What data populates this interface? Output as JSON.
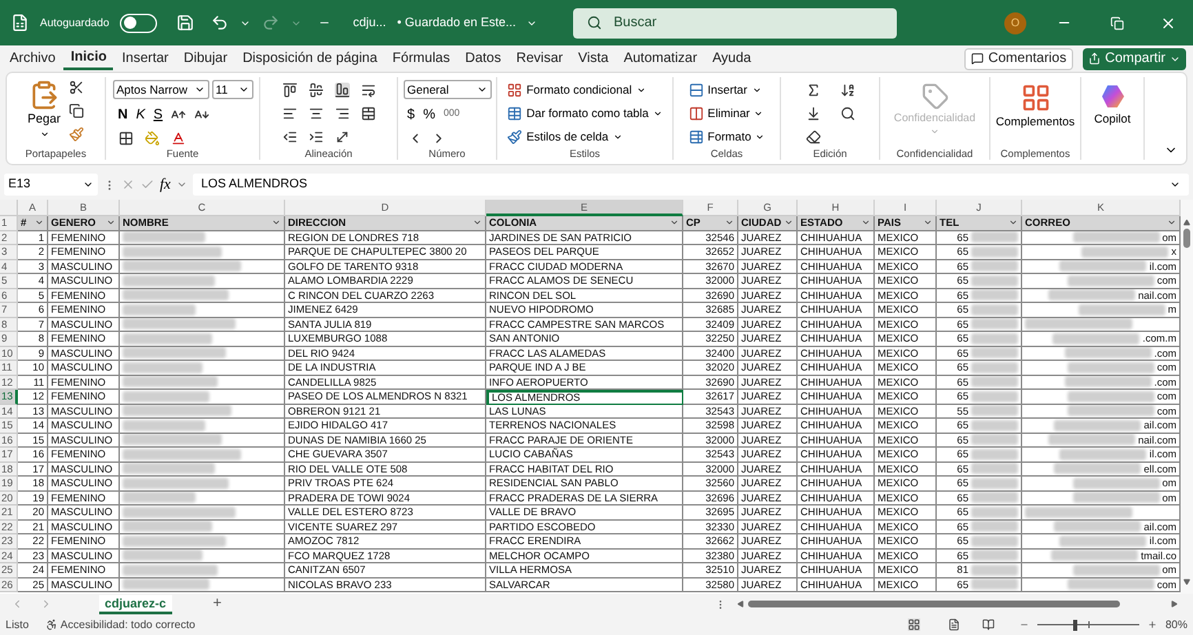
{
  "title_bar": {
    "autosave_label": "Autoguardado",
    "autosave_on": false,
    "file_name": "cdju...",
    "save_status": "• Guardado en Este...",
    "search_placeholder": "Buscar",
    "avatar_initial": "O"
  },
  "menu": {
    "tabs": [
      {
        "label": "Archivo",
        "selected": false
      },
      {
        "label": "Inicio",
        "selected": true
      },
      {
        "label": "Insertar",
        "selected": false
      },
      {
        "label": "Dibujar",
        "selected": false
      },
      {
        "label": "Disposición de página",
        "selected": false
      },
      {
        "label": "Fórmulas",
        "selected": false
      },
      {
        "label": "Datos",
        "selected": false
      },
      {
        "label": "Revisar",
        "selected": false
      },
      {
        "label": "Vista",
        "selected": false
      },
      {
        "label": "Automatizar",
        "selected": false
      },
      {
        "label": "Ayuda",
        "selected": false
      }
    ],
    "comments_button": "Comentarios",
    "share_button": "Compartir"
  },
  "ribbon": {
    "groups": [
      {
        "kind": "clipboard",
        "label": "Portapapeles",
        "paste": "Pegar"
      },
      {
        "kind": "font",
        "label": "Fuente",
        "font_name": "Aptos Narrow",
        "font_size": "11",
        "bold": "N",
        "italic": "K",
        "underline": "S"
      },
      {
        "kind": "alignment",
        "label": "Alineación"
      },
      {
        "kind": "number",
        "label": "Número",
        "format": "General",
        "currency": "$",
        "percent": "%",
        "thousands": "000"
      },
      {
        "kind": "styles",
        "label": "Estilos",
        "items": [
          "Formato condicional",
          "Dar formato como tabla",
          "Estilos de celda"
        ]
      },
      {
        "kind": "cells",
        "label": "Celdas",
        "items": [
          "Insertar",
          "Eliminar",
          "Formato"
        ]
      },
      {
        "kind": "editing",
        "label": "Edición"
      },
      {
        "kind": "sensitivity",
        "label": "Confidencialidad",
        "button": "Confidencialidad",
        "disabled": true
      },
      {
        "kind": "addins",
        "label": "Complementos",
        "button": "Complementos"
      },
      {
        "kind": "copilot",
        "button": "Copilot"
      }
    ]
  },
  "formula_bar": {
    "cell_ref": "E13",
    "fx": "fx",
    "value": "LOS ALMENDROS"
  },
  "sheet": {
    "columns": [
      {
        "letter": "A",
        "header": "#",
        "kind": "number",
        "selected": false
      },
      {
        "letter": "B",
        "header": "GENERO",
        "kind": "text",
        "selected": false
      },
      {
        "letter": "C",
        "header": "NOMBRE",
        "kind": "blurred",
        "selected": false
      },
      {
        "letter": "D",
        "header": "DIRECCION",
        "kind": "text",
        "selected": false
      },
      {
        "letter": "E",
        "header": "COLONIA",
        "kind": "text",
        "selected": true
      },
      {
        "letter": "F",
        "header": "CP",
        "kind": "number",
        "selected": false
      },
      {
        "letter": "G",
        "header": "CIUDAD",
        "kind": "text",
        "selected": false
      },
      {
        "letter": "H",
        "header": "ESTADO",
        "kind": "text",
        "selected": false
      },
      {
        "letter": "I",
        "header": "PAIS",
        "kind": "text",
        "selected": false
      },
      {
        "letter": "J",
        "header": "TEL",
        "kind": "blurred-number",
        "selected": false
      },
      {
        "letter": "K",
        "header": "CORREO",
        "kind": "blurred-text",
        "selected": false
      }
    ],
    "header_row_number": "1",
    "rows": [
      {
        "row_number": "2",
        "selected": false,
        "cells": [
          "1",
          "FEMENINO",
          "",
          "REGION DE LONDRES 718",
          "JARDINES DE SAN PATRICIO",
          "32546",
          "JUAREZ",
          "CHIHUAHUA",
          "MEXICO",
          "65",
          "om"
        ]
      },
      {
        "row_number": "3",
        "selected": false,
        "cells": [
          "2",
          "FEMENINO",
          "",
          "PARQUE DE CHAPULTEPEC 3800 20",
          "PASEOS DEL PARQUE",
          "32652",
          "JUAREZ",
          "CHIHUAHUA",
          "MEXICO",
          "65",
          "x"
        ]
      },
      {
        "row_number": "4",
        "selected": false,
        "cells": [
          "3",
          "MASCULINO",
          "",
          "GOLFO DE TARENTO 9318",
          "FRACC CIUDAD MODERNA",
          "32670",
          "JUAREZ",
          "CHIHUAHUA",
          "MEXICO",
          "65",
          "il.com"
        ]
      },
      {
        "row_number": "5",
        "selected": false,
        "cells": [
          "4",
          "MASCULINO",
          "",
          "ALAMO LOMBARDIA 2229",
          "FRACC ALAMOS DE SENECU",
          "32000",
          "JUAREZ",
          "CHIHUAHUA",
          "MEXICO",
          "65",
          "com"
        ]
      },
      {
        "row_number": "6",
        "selected": false,
        "cells": [
          "5",
          "FEMENINO",
          "",
          "C RINCON DEL CUARZO 2263",
          "RINCON DEL SOL",
          "32690",
          "JUAREZ",
          "CHIHUAHUA",
          "MEXICO",
          "65",
          "nail.com"
        ]
      },
      {
        "row_number": "7",
        "selected": false,
        "cells": [
          "6",
          "FEMENINO",
          "",
          "JIMENEZ 6429",
          "NUEVO HIPODROMO",
          "32685",
          "JUAREZ",
          "CHIHUAHUA",
          "MEXICO",
          "65",
          "m"
        ]
      },
      {
        "row_number": "8",
        "selected": false,
        "cells": [
          "7",
          "MASCULINO",
          "",
          "SANTA JULIA 819",
          "FRACC CAMPESTRE SAN MARCOS",
          "32409",
          "JUAREZ",
          "CHIHUAHUA",
          "MEXICO",
          "65",
          ""
        ]
      },
      {
        "row_number": "9",
        "selected": false,
        "cells": [
          "8",
          "FEMENINO",
          "",
          "LUXEMBURGO 1088",
          "SAN ANTONIO",
          "32250",
          "JUAREZ",
          "CHIHUAHUA",
          "MEXICO",
          "65",
          ".com.m"
        ]
      },
      {
        "row_number": "10",
        "selected": false,
        "cells": [
          "9",
          "MASCULINO",
          "",
          "DEL RIO 9424",
          "FRACC LAS ALAMEDAS",
          "32400",
          "JUAREZ",
          "CHIHUAHUA",
          "MEXICO",
          "65",
          ".com"
        ]
      },
      {
        "row_number": "11",
        "selected": false,
        "cells": [
          "10",
          "MASCULINO",
          "",
          "DE LA INDUSTRIA",
          "PARQUE IND A J BE",
          "32020",
          "JUAREZ",
          "CHIHUAHUA",
          "MEXICO",
          "65",
          "com"
        ]
      },
      {
        "row_number": "12",
        "selected": false,
        "cells": [
          "11",
          "FEMENINO",
          "",
          "CANDELILLA 9825",
          "INFO AEROPUERTO",
          "32690",
          "JUAREZ",
          "CHIHUAHUA",
          "MEXICO",
          "65",
          ".com"
        ]
      },
      {
        "row_number": "13",
        "selected": true,
        "cells": [
          "12",
          "FEMENINO",
          "",
          "PASEO DE LOS ALMENDROS N 8321",
          "LOS ALMENDROS",
          "32617",
          "JUAREZ",
          "CHIHUAHUA",
          "MEXICO",
          "65",
          "com"
        ]
      },
      {
        "row_number": "14",
        "selected": false,
        "cells": [
          "13",
          "MASCULINO",
          "",
          "OBRERON 9121 21",
          "LAS LUNAS",
          "32543",
          "JUAREZ",
          "CHIHUAHUA",
          "MEXICO",
          "55",
          "com"
        ]
      },
      {
        "row_number": "15",
        "selected": false,
        "cells": [
          "14",
          "MASCULINO",
          "",
          "EJIDO HIDALGO 417",
          "TERRENOS NACIONALES",
          "32598",
          "JUAREZ",
          "CHIHUAHUA",
          "MEXICO",
          "65",
          "ail.com"
        ]
      },
      {
        "row_number": "16",
        "selected": false,
        "cells": [
          "15",
          "MASCULINO",
          "",
          "DUNAS DE NAMIBIA 1660 25",
          "FRACC PARAJE DE ORIENTE",
          "32000",
          "JUAREZ",
          "CHIHUAHUA",
          "MEXICO",
          "65",
          "nail.com"
        ]
      },
      {
        "row_number": "17",
        "selected": false,
        "cells": [
          "16",
          "FEMENINO",
          "",
          "CHE GUEVARA 3507",
          "LUCIO CABAÑAS",
          "32543",
          "JUAREZ",
          "CHIHUAHUA",
          "MEXICO",
          "65",
          "il.com"
        ]
      },
      {
        "row_number": "18",
        "selected": false,
        "cells": [
          "17",
          "MASCULINO",
          "",
          "RIO DEL VALLE OTE 508",
          "FRACC HABITAT DEL RIO",
          "32000",
          "JUAREZ",
          "CHIHUAHUA",
          "MEXICO",
          "65",
          "ell.com"
        ]
      },
      {
        "row_number": "19",
        "selected": false,
        "cells": [
          "18",
          "MASCULINO",
          "",
          "PRIV TROAS PTE 624",
          "RESIDENCIAL SAN PABLO",
          "32560",
          "JUAREZ",
          "CHIHUAHUA",
          "MEXICO",
          "65",
          "om"
        ]
      },
      {
        "row_number": "20",
        "selected": false,
        "cells": [
          "19",
          "FEMENINO",
          "",
          "PRADERA DE TOWI 9024",
          "FRACC PRADERAS DE LA SIERRA",
          "32696",
          "JUAREZ",
          "CHIHUAHUA",
          "MEXICO",
          "65",
          "om"
        ]
      },
      {
        "row_number": "21",
        "selected": false,
        "cells": [
          "20",
          "MASCULINO",
          "",
          "VALLE DEL ESTERO 8723",
          "VALLE DE BRAVO",
          "32695",
          "JUAREZ",
          "CHIHUAHUA",
          "MEXICO",
          "65",
          ""
        ]
      },
      {
        "row_number": "22",
        "selected": false,
        "cells": [
          "21",
          "MASCULINO",
          "",
          "VICENTE SUAREZ 297",
          "PARTIDO ESCOBEDO",
          "32330",
          "JUAREZ",
          "CHIHUAHUA",
          "MEXICO",
          "65",
          "ail.com"
        ]
      },
      {
        "row_number": "23",
        "selected": false,
        "cells": [
          "22",
          "FEMENINO",
          "",
          "AMOZOC 7812",
          "FRACC ERENDIRA",
          "32662",
          "JUAREZ",
          "CHIHUAHUA",
          "MEXICO",
          "65",
          "il.com"
        ]
      },
      {
        "row_number": "24",
        "selected": false,
        "cells": [
          "23",
          "MASCULINO",
          "",
          "FCO MARQUEZ 1728",
          "MELCHOR OCAMPO",
          "32380",
          "JUAREZ",
          "CHIHUAHUA",
          "MEXICO",
          "65",
          "tmail.co"
        ]
      },
      {
        "row_number": "25",
        "selected": false,
        "cells": [
          "24",
          "FEMENINO",
          "",
          "CANITZAN 6507",
          "VILLA HERMOSA",
          "32510",
          "JUAREZ",
          "CHIHUAHUA",
          "MEXICO",
          "81",
          "om"
        ]
      },
      {
        "row_number": "26",
        "selected": false,
        "cells": [
          "25",
          "MASCULINO",
          "",
          "NICOLAS BRAVO 233",
          "SALVARCAR",
          "32580",
          "JUAREZ",
          "CHIHUAHUA",
          "MEXICO",
          "65",
          "com"
        ]
      }
    ]
  },
  "sheet_tabs": [
    {
      "label": "cdjuarez-c",
      "selected": true
    }
  ],
  "add_sheet": "+",
  "status_bar": {
    "ready": "Listo",
    "accessibility": "Accesibilidad: todo correcto",
    "zoom": {
      "level": 0.37,
      "reading": "80%"
    }
  }
}
